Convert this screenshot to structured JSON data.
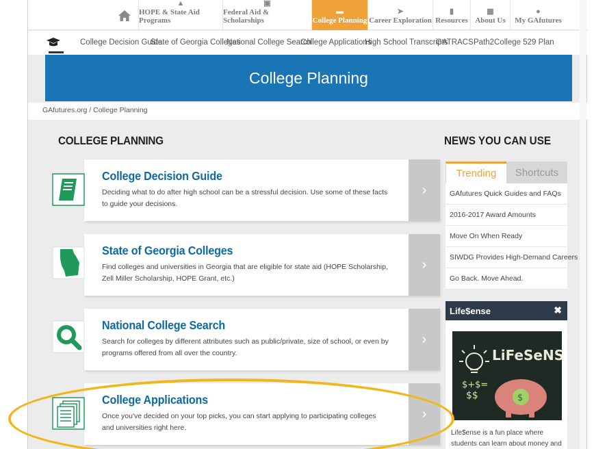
{
  "topnav": {
    "items": [
      {
        "label": "HOPE & State Aid Programs",
        "icon": "graduation-icon"
      },
      {
        "label": "Federal Aid & Scholarships",
        "icon": "money-icon"
      },
      {
        "label": "College Planning",
        "icon": "cap-icon",
        "active": true
      },
      {
        "label": "Career Exploration",
        "icon": "arrow-icon"
      },
      {
        "label": "Resources",
        "icon": "document-icon"
      },
      {
        "label": "About Us",
        "icon": "building-icon"
      },
      {
        "label": "My GAfutures",
        "icon": "person-icon"
      }
    ]
  },
  "subnav": {
    "items": [
      "College Decision Guide",
      "State of Georgia Colleges",
      "National College Search",
      "College Applications",
      "High School Transcripts",
      "GATRACS",
      "Path2College 529 Plan"
    ]
  },
  "banner": {
    "title": "College Planning"
  },
  "breadcrumb": "GAfutures.org / College Planning",
  "main": {
    "section_title": "COLLEGE PLANNING",
    "cards": [
      {
        "title": "College Decision Guide",
        "desc": "Deciding what to do after high school can be a stressful decision. Use some of these facts to guide your decisions.",
        "icon": "book-icon"
      },
      {
        "title": "State of Georgia Colleges",
        "desc": "Find colleges and universities in Georgia that are eligible for state aid (HOPE Scholarship, Zell Miller Scholarship, HOPE Grant, etc.)",
        "icon": "georgia-map-icon"
      },
      {
        "title": "National College Search",
        "desc": "Search for colleges by different attributes such as public/private, size of school, or even by programs offered from all over the country.",
        "icon": "search-icon"
      },
      {
        "title": "College Applications",
        "desc": "Once you've decided on your top picks, you can start applying to participating colleges and universities right here.",
        "icon": "documents-icon"
      }
    ]
  },
  "sidebar": {
    "news_title": "NEWS YOU CAN USE",
    "tabs": [
      "Trending",
      "Shortcuts"
    ],
    "news_items": [
      "GAfutures Quick Guides and FAQs",
      "2016-2017 Award Amounts",
      "Move On When Ready",
      "SIWDG Provides High-Demand Careers",
      "Go Back. Move Ahead."
    ],
    "lifesense": {
      "title": "Life$ense",
      "close": "✖",
      "logo_text": "LiFeSeNSe",
      "text": "Life$ense is a fun place where students can learn about money and what it"
    }
  },
  "colors": {
    "accent": "#f0a23a",
    "banner": "#1a75b5",
    "card_title": "#0c6aa0",
    "icon_green": "#1f9a5a",
    "highlight": "#f3b51c"
  }
}
